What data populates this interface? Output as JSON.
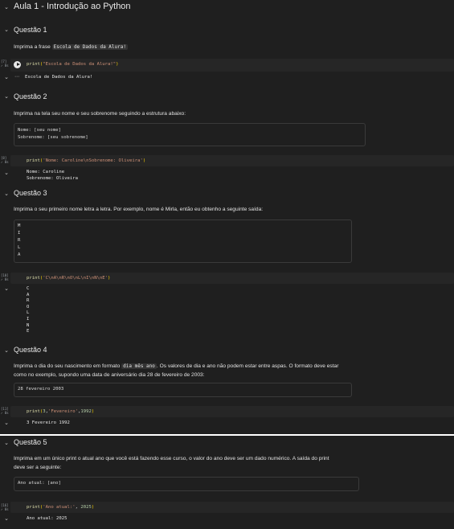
{
  "title": "Aula 1 - Introdução ao Python",
  "q1": {
    "heading": "Questão 1",
    "text": "Imprima a frase",
    "code_inline": "Escola de Dados da Alura!",
    "exec_count": "[7]",
    "exec_time": "0s",
    "code": {
      "fn": "print",
      "arg": "\"Escola de Dados da Alura!\""
    },
    "output": "Escola de Dados da Alura!"
  },
  "q2": {
    "heading": "Questão 2",
    "text": "Imprima na tela seu nome e seu sobrenome seguindo a estrutura abaixo:",
    "box_lines": [
      "Nome: [seu nome]",
      "Sobrenome: [seu sobrenome]"
    ],
    "exec_count": "[8]",
    "exec_time": "0s",
    "code": {
      "fn": "print",
      "arg": "'Nome: Caroline\\nSobrenome: Oliveira'"
    },
    "output": [
      "Nome: Caroline",
      "Sobrenome: Oliveira"
    ]
  },
  "q3": {
    "heading": "Questão 3",
    "text": "Imprima o seu primeiro nome letra a letra. Por exemplo, nome é Mirla, então eu obtenho a seguinte saída:",
    "box_letters": [
      "M",
      "I",
      "R",
      "L",
      "A"
    ],
    "exec_count": "[10]",
    "exec_time": "0s",
    "code": {
      "fn": "print",
      "arg": "'C\\nA\\nR\\nO\\nL\\nI\\nN\\nE'"
    },
    "output": [
      "C",
      "A",
      "R",
      "O",
      "L",
      "I",
      "N",
      "E"
    ]
  },
  "q4": {
    "heading": "Questão 4",
    "text_a": "Imprima o dia do seu nascimento em formato",
    "code_inline": "dia mês ano",
    "text_b": ". Os valores de dia e ano não podem estar entre aspas. O formato deve estar",
    "text_c": "como no exemplo, supondo uma data de aniversário dia 28 de fevereiro de 2003:",
    "box_line": "28 fevereiro 2003",
    "exec_count": "[11]",
    "exec_time": "0s",
    "code": {
      "fn": "print",
      "n1": "3",
      "s": "'Fevereiro'",
      "n2": "1992"
    },
    "output": "3 Fevereiro 1992"
  },
  "q5": {
    "heading": "Questão 5",
    "text_a": "Imprima em um único print o atual ano que você está fazendo esse curso, o valor do ano deve ser um dado numérico. A saída do print",
    "text_b": "deve ser a seguinte:",
    "box_line": "Ano atual: [ano]",
    "exec_count": "[16]",
    "exec_time": "0s",
    "code": {
      "fn": "print",
      "s": "'Ano atual:'",
      "n": "2025"
    },
    "output": "Ano atual: 2025"
  },
  "colors": {
    "bg": "#1f1f1f",
    "cell": "#262626",
    "string": "#ce9178",
    "number": "#b5cea8",
    "function": "#dcdcaa"
  },
  "icons": [
    "chevron-down-icon",
    "run-button-icon",
    "output-menu-icon",
    "check-icon"
  ]
}
